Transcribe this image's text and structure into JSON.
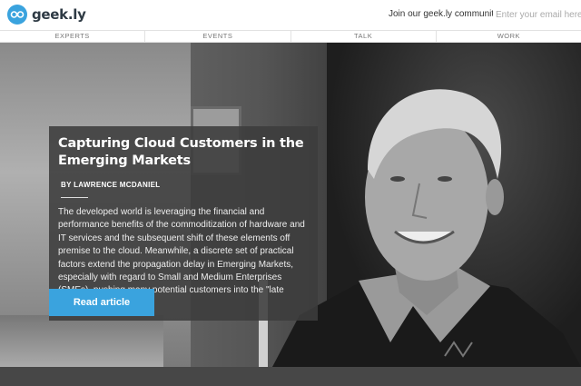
{
  "header": {
    "brand": "geek.ly",
    "join_text": "Join our geek.ly community",
    "email_placeholder": "Enter your email here"
  },
  "nav": {
    "items": [
      "EXPERTS",
      "EVENTS",
      "TALK",
      "WORK"
    ]
  },
  "article": {
    "title": "Capturing Cloud Customers in the Emerging Markets",
    "byline": "BY LAWRENCE MCDANIEL",
    "body": "The developed world is leveraging the financial and performance benefits of the commoditization of hardware and IT services and the subsequent shift of these elements off premise to the cloud. Meanwhile, a discrete set of practical factors extend the propagation delay in Emerging Markets, especially with regard to Small and Medium Enterprises (SMEs), pushing many potential customers into the \"late majority\" category.",
    "cta_label": "Read article"
  },
  "colors": {
    "accent": "#3aa3de",
    "card_bg": "#3c3c3c",
    "footer": "#474747"
  }
}
